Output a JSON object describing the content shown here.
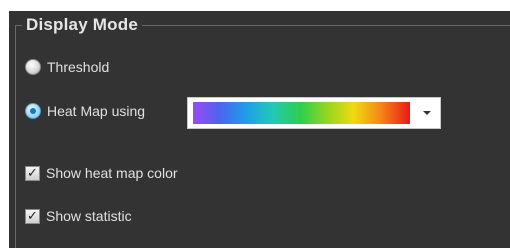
{
  "group": {
    "title": "Display Mode"
  },
  "options": {
    "threshold_label": "Threshold",
    "threshold_selected": false,
    "heatmap_label": "Heat Map using",
    "heatmap_selected": true
  },
  "colormap": {
    "selected": "rainbow-gradient",
    "colors": [
      "#9a4bf2",
      "#4d63f0",
      "#1f9ce8",
      "#22c7b8",
      "#2fcf4a",
      "#96d61f",
      "#f2d912",
      "#f58a16",
      "#e81a1a"
    ]
  },
  "checkboxes": {
    "show_heat_map_color_label": "Show heat map color",
    "show_heat_map_color_checked": true,
    "show_statistic_label": "Show statistic",
    "show_statistic_checked": true
  },
  "icons": {
    "dropdown": "chevron-down-icon",
    "check": "checkmark-icon"
  }
}
